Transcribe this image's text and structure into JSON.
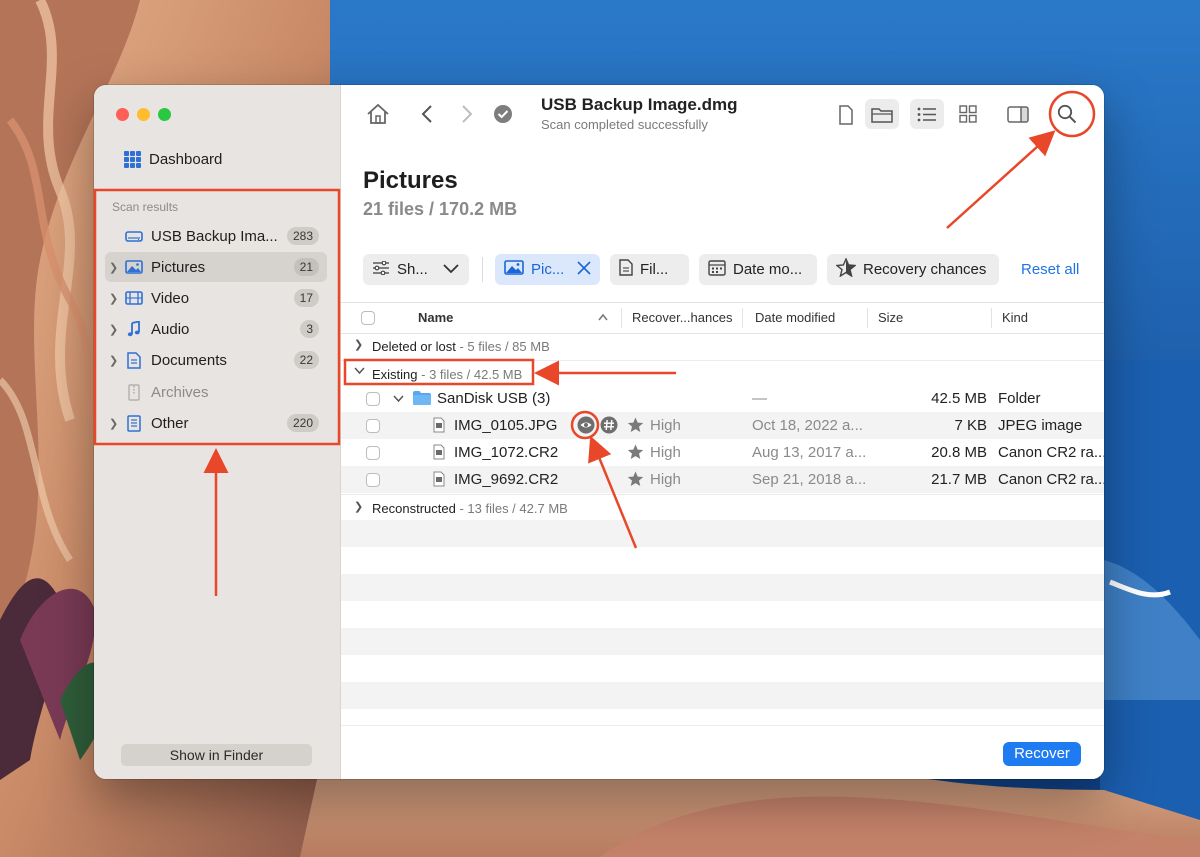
{
  "window": {
    "title": "USB Backup Image.dmg",
    "subtitle": "Scan completed successfully"
  },
  "sidebar": {
    "dashboard_label": "Dashboard",
    "section_label": "Scan results",
    "items": [
      {
        "label": "USB Backup Ima...",
        "count": "283",
        "icon": "drive-icon",
        "selected": false
      },
      {
        "label": "Pictures",
        "count": "21",
        "icon": "picture-icon",
        "selected": true
      },
      {
        "label": "Video",
        "count": "17",
        "icon": "film-icon",
        "selected": false
      },
      {
        "label": "Audio",
        "count": "3",
        "icon": "music-note-icon",
        "selected": false
      },
      {
        "label": "Documents",
        "count": "22",
        "icon": "document-icon",
        "selected": false
      },
      {
        "label": "Archives",
        "count": "",
        "icon": "archive-icon",
        "selected": false
      },
      {
        "label": "Other",
        "count": "220",
        "icon": "other-file-icon",
        "selected": false
      }
    ],
    "show_in_finder": "Show in Finder"
  },
  "main": {
    "title": "Pictures",
    "summary": "21 files / 170.2 MB",
    "filters": {
      "show": "Sh...",
      "pictures": "Pic...",
      "file": "Fil...",
      "date": "Date mo...",
      "recovery": "Recovery chances",
      "reset": "Reset all"
    },
    "columns": {
      "name": "Name",
      "recovery": "Recover...hances",
      "date": "Date modified",
      "size": "Size",
      "kind": "Kind"
    },
    "groups": {
      "deleted": {
        "label": "Deleted or lost",
        "meta": " - 5 files / 85 MB"
      },
      "existing": {
        "label": "Existing",
        "meta": " - 3 files / 42.5 MB"
      },
      "reconstructed": {
        "label": "Reconstructed",
        "meta": " - 13 files / 42.7 MB"
      }
    },
    "folder": {
      "name": "SanDisk USB (3)",
      "date": "—",
      "size": "42.5 MB",
      "kind": "Folder"
    },
    "files": [
      {
        "name": "IMG_0105.JPG",
        "chance": "High",
        "date": "Oct 18, 2022 a...",
        "size": "7 KB",
        "kind": "JPEG image"
      },
      {
        "name": "IMG_1072.CR2",
        "chance": "High",
        "date": "Aug 13, 2017 a...",
        "size": "20.8 MB",
        "kind": "Canon CR2 ra..."
      },
      {
        "name": "IMG_9692.CR2",
        "chance": "High",
        "date": "Sep 21, 2018 a...",
        "size": "21.7 MB",
        "kind": "Canon CR2 ra..."
      }
    ],
    "recover_label": "Recover"
  },
  "colors": {
    "accent": "#1f7bf2",
    "annotation": "#e8472a",
    "sidebar_bg": "#e8e4e1"
  }
}
